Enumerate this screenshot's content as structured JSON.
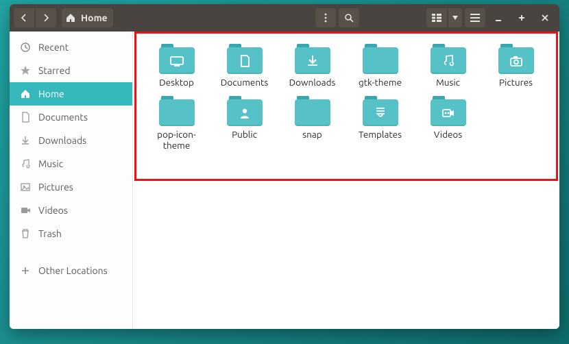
{
  "window": {
    "title": "Home"
  },
  "sidebar": {
    "items": [
      {
        "id": "recent",
        "label": "Recent"
      },
      {
        "id": "starred",
        "label": "Starred"
      },
      {
        "id": "home",
        "label": "Home",
        "active": true
      },
      {
        "id": "documents",
        "label": "Documents"
      },
      {
        "id": "downloads",
        "label": "Downloads"
      },
      {
        "id": "music",
        "label": "Music"
      },
      {
        "id": "pictures",
        "label": "Pictures"
      },
      {
        "id": "videos",
        "label": "Videos"
      },
      {
        "id": "trash",
        "label": "Trash"
      }
    ],
    "other_locations_label": "Other Locations"
  },
  "folders": [
    {
      "label": "Desktop",
      "glyph": "desktop"
    },
    {
      "label": "Documents",
      "glyph": "document"
    },
    {
      "label": "Downloads",
      "glyph": "download"
    },
    {
      "label": "gtk-theme",
      "glyph": ""
    },
    {
      "label": "Music",
      "glyph": "music"
    },
    {
      "label": "Pictures",
      "glyph": "camera"
    },
    {
      "label": "pop-icon-theme",
      "glyph": ""
    },
    {
      "label": "Public",
      "glyph": "public"
    },
    {
      "label": "snap",
      "glyph": ""
    },
    {
      "label": "Templates",
      "glyph": "templates"
    },
    {
      "label": "Videos",
      "glyph": "video"
    }
  ]
}
